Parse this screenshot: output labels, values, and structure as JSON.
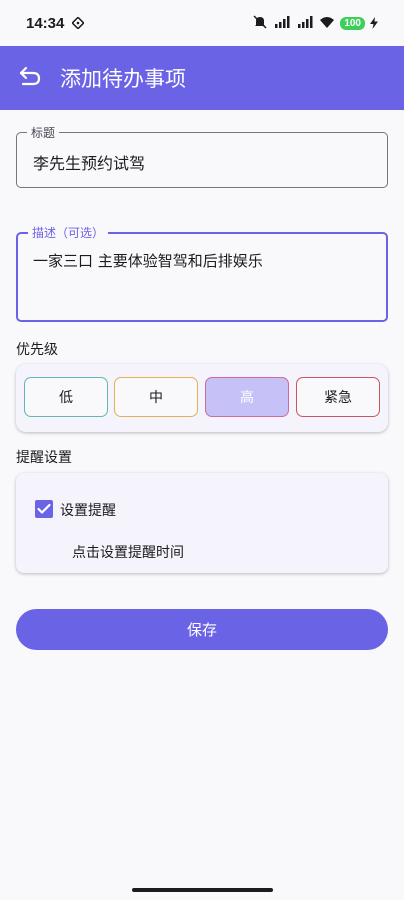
{
  "status": {
    "time": "14:34",
    "battery": "100"
  },
  "app_bar": {
    "title": "添加待办事项"
  },
  "title_field": {
    "label": "标题",
    "value": "李先生预约试驾"
  },
  "description_field": {
    "label": "描述（可选）",
    "value": "一家三口 主要体验智驾和后排娱乐"
  },
  "priority": {
    "section_title": "优先级",
    "options": [
      {
        "label": "低",
        "color": "#5fb8b4",
        "selected": false
      },
      {
        "label": "中",
        "color": "#e0b25a",
        "selected": false
      },
      {
        "label": "高",
        "color": "#d06a9a",
        "selected": true
      },
      {
        "label": "紧急",
        "color": "#c9575f",
        "selected": false
      }
    ]
  },
  "reminder": {
    "section_title": "提醒设置",
    "checkbox_label": "设置提醒",
    "checked": true,
    "time_link": "点击设置提醒时间"
  },
  "save_button": {
    "label": "保存"
  },
  "colors": {
    "accent": "#6b63e6",
    "selected_fill": "#c6c1f7"
  }
}
